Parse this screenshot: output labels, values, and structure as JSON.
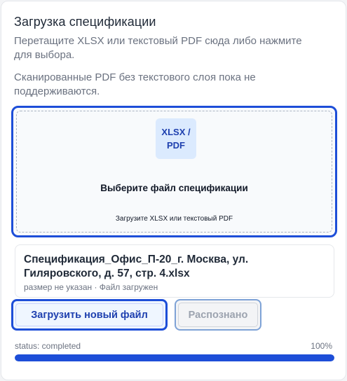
{
  "header": {
    "title": "Загрузка спецификации",
    "description_1": "Перетащите XLSX или текстовый PDF сюда либо нажмите для выбора.",
    "description_2": "Сканированные PDF без текстового слоя пока не поддерживаются."
  },
  "dropzone": {
    "badge_line1": "XLSX /",
    "badge_line2": "PDF",
    "badge_icon": "file-type-icon",
    "title": "Выберите файл спецификации",
    "subtitle": "Загрузите XLSX или текстовый PDF"
  },
  "file": {
    "name": "Спецификация_Офис_П-20_г. Москва, ул. Гиляровского, д. 57, стр. 4.xlsx",
    "meta": "размер не указан · Файл загружен"
  },
  "actions": {
    "upload_label": "Загрузить новый файл",
    "recognized_label": "Распознано"
  },
  "status": {
    "text": "status: completed",
    "percent_label": "100%",
    "progress": 1.0
  },
  "colors": {
    "accent": "#1d4ed8",
    "badge_bg": "#dbeafe",
    "muted_text": "#6b7280"
  }
}
